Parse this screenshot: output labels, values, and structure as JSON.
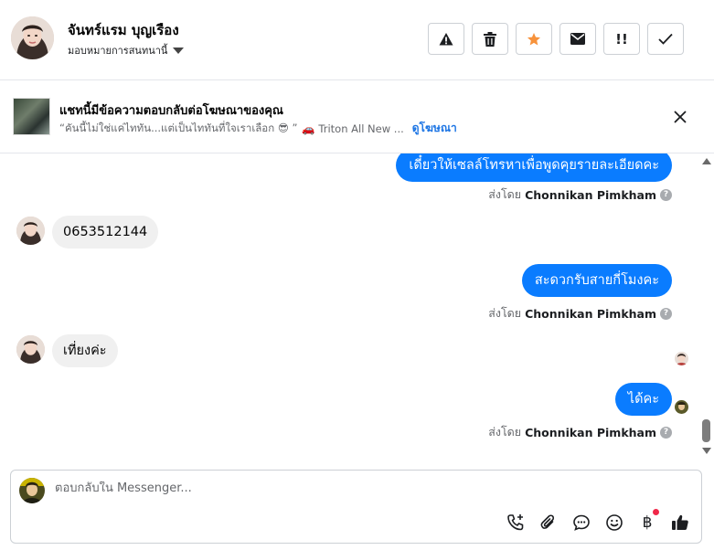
{
  "header": {
    "contact_name": "จันทร์แรม บุญเรือง",
    "assign_label": "มอบหมายการสนทนานี้",
    "actions": [
      {
        "name": "report-spam",
        "icon": "warning-icon"
      },
      {
        "name": "delete",
        "icon": "trash-icon"
      },
      {
        "name": "star",
        "icon": "star-icon",
        "color": "#f7923b"
      },
      {
        "name": "mark-unread",
        "icon": "envelope-icon"
      },
      {
        "name": "follow-up",
        "icon": "exclamation-icon",
        "text": "!!"
      },
      {
        "name": "mark-done",
        "icon": "check-icon"
      }
    ]
  },
  "ad_banner": {
    "title": "แชทนี้มีข้อความตอบกลับต่อโฆษณาของคุณ",
    "snippet": "“คันนี้ไม่ใช่แค่ไททัน...แต่เป็นไททันที่ใจเราเลือก 😎 ”",
    "ad_name": "🚗 Triton All New ...",
    "view_ad_link": "ดูโฆษณา"
  },
  "messages": {
    "m1": {
      "direction": "out",
      "text": "เดี๋ยวให้เซลล์โทรหาเพื่อพูดคุยรายละเอียดคะ"
    },
    "m1_sent_prefix": "ส่งโดย",
    "m1_sender": "Chonnikan Pimkham",
    "m2": {
      "direction": "in",
      "text": "0653512144"
    },
    "m3": {
      "direction": "out",
      "text": "สะดวกรับสายกี่โมงคะ"
    },
    "m3_sent_prefix": "ส่งโดย",
    "m3_sender": "Chonnikan Pimkham",
    "m4": {
      "direction": "in",
      "text": "เที่ยงค่ะ"
    },
    "m5": {
      "direction": "out",
      "text": "ได้คะ"
    },
    "m5_sent_prefix": "ส่งโดย",
    "m5_sender": "Chonnikan Pimkham",
    "help_icon": "?"
  },
  "composer": {
    "placeholder": "ตอบกลับใน Messenger...",
    "tools": [
      "call-icon",
      "paperclip-icon",
      "saved-reply-icon",
      "emoji-icon",
      "baht-payment-icon",
      "thumbs-up-icon"
    ],
    "baht_symbol": "฿"
  },
  "colors": {
    "outgoing_bubble": "#0a7cff",
    "incoming_bubble": "#f0f0f0",
    "link": "#1b74e4",
    "star": "#f7923b",
    "notification_dot": "#f02849"
  }
}
